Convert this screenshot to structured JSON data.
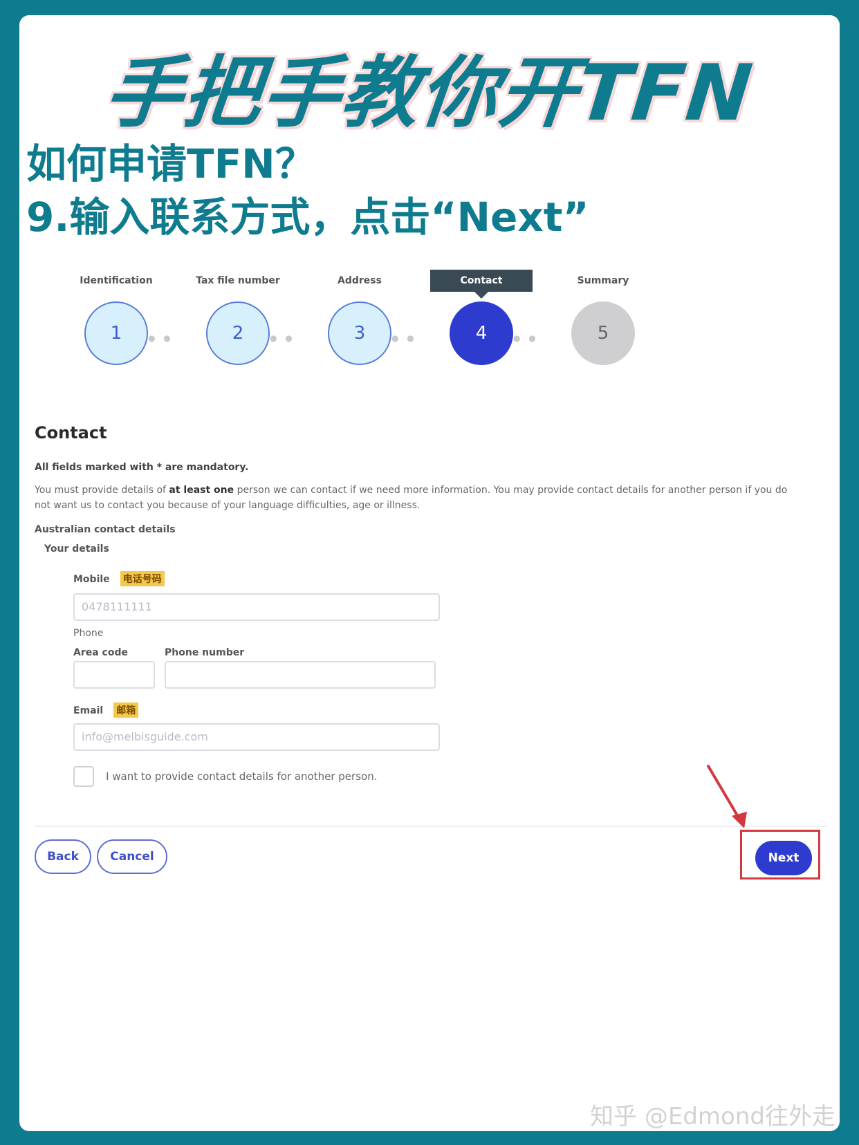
{
  "header": {
    "big_title": "手把手教你开TFN",
    "subtitle_1": "如何申请TFN？",
    "subtitle_2": "9.输入联系方式，点击“Next”"
  },
  "stepper": {
    "steps": [
      {
        "label": "Identification",
        "number": "1",
        "state": "done"
      },
      {
        "label": "Tax file number",
        "number": "2",
        "state": "done"
      },
      {
        "label": "Address",
        "number": "3",
        "state": "done"
      },
      {
        "label": "Contact",
        "number": "4",
        "state": "current"
      },
      {
        "label": "Summary",
        "number": "5",
        "state": "todo"
      }
    ]
  },
  "form": {
    "heading": "Contact",
    "mandatory_note": "All fields marked with * are mandatory.",
    "info_pre": "You must provide details of ",
    "info_bold": "at least one",
    "info_post": " person we can contact if we need more information. You may provide contact details for another person if you do not want us to contact you because of your language difficulties, age or illness.",
    "section_label": "Australian contact details",
    "sub_label": "Your details",
    "mobile_label": "Mobile",
    "mobile_tag": "电话号码",
    "mobile_value": "0478111111",
    "phone_label": "Phone",
    "area_code_label": "Area code",
    "phone_number_label": "Phone number",
    "email_label": "Email",
    "email_tag": "邮箱",
    "email_value": "info@melbisguide.com",
    "checkbox_label": "I want to provide contact details for another person."
  },
  "buttons": {
    "back": "Back",
    "cancel": "Cancel",
    "next": "Next"
  },
  "colors": {
    "brand_teal": "#0e7b8f",
    "primary_blue": "#2e3bcf",
    "highlight_red": "#d2393f",
    "tag_yellow": "#f4c84a"
  },
  "watermark": "知乎 @Edmond往外走"
}
